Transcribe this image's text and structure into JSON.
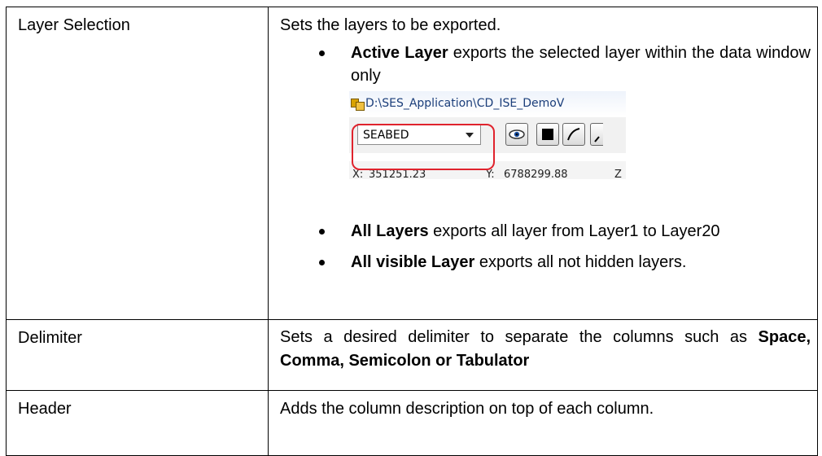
{
  "rows": [
    {
      "label": "Layer Selection",
      "intro": "Sets the layers to be exported.",
      "bullets": [
        {
          "bold": "Active Layer",
          "text": " exports the selected layer within the data window only"
        },
        {
          "bold": "All Layers",
          "text": " exports all layer from Layer1 to Layer20"
        },
        {
          "bold": "All visible Layer",
          "text": " exports all not hidden layers."
        }
      ],
      "screenshot": {
        "path": "D:\\SES_Application\\CD_ISE_DemoV",
        "layer_value": "SEABED",
        "x_label": "X:",
        "x_value": "351251.23",
        "y_label": "Y:",
        "y_value": "6788299.88",
        "z_label": "Z",
        "highlight_color": "#e0232d"
      }
    },
    {
      "label": "Delimiter",
      "text_before": "Sets a desired delimiter to separate the columns such as ",
      "bold": "Space, Comma, Semicolon or Tabulator"
    },
    {
      "label": "Header",
      "text": "Adds the column description on top of each column."
    }
  ]
}
